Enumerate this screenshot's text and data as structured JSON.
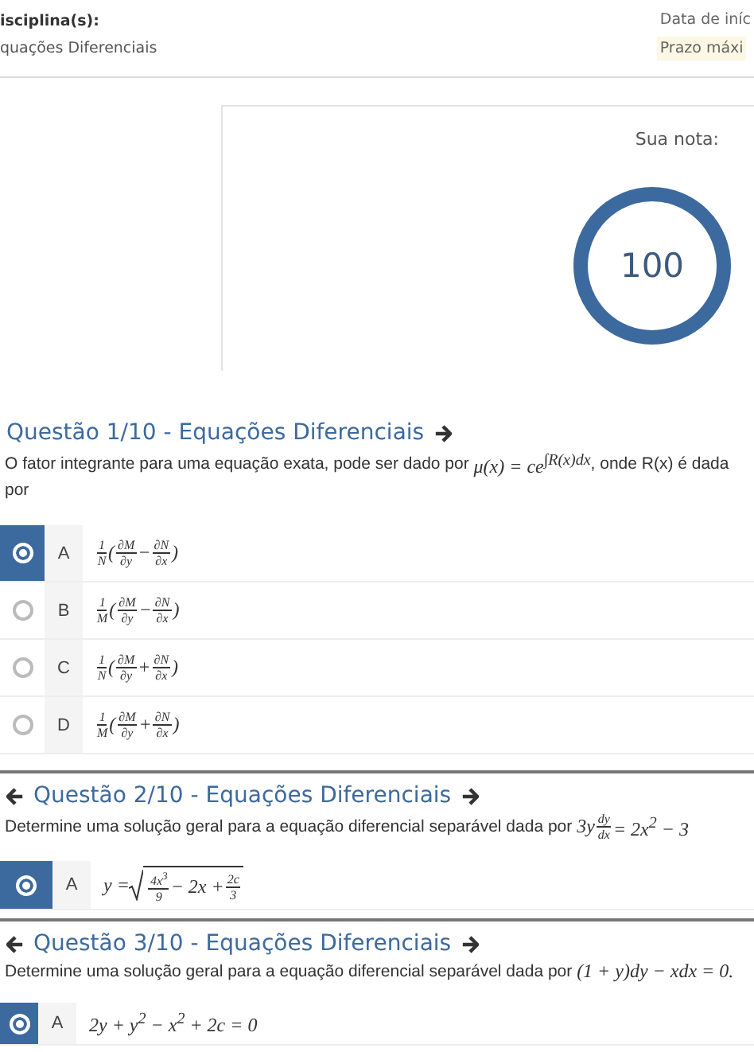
{
  "header": {
    "left": {
      "label": "isciplina(s):",
      "value": "quações Diferenciais"
    },
    "right": [
      {
        "text": "Data de iníc",
        "highlight": false
      },
      {
        "text": "Prazo máxi",
        "highlight": true
      }
    ]
  },
  "score": {
    "label": "Sua nota:",
    "value": "100",
    "level": 1
  },
  "questions": [
    {
      "title": "Questão 1/10 - Equações Diferenciais",
      "has_prev": false,
      "has_next": true,
      "statement": [
        {
          "kind": "text",
          "text": "O fator integrante para uma equação exata, pode ser dado por "
        },
        {
          "kind": "math",
          "tokens": [
            {
              "kind": "text",
              "text": "μ(x) = ce$^{∫R(x)dx}$"
            }
          ]
        },
        {
          "kind": "text",
          "text": ", onde R(x) é dada por"
        }
      ],
      "options": [
        {
          "letter": "A",
          "selected": true,
          "formula": [
            {
              "kind": "frac",
              "num": "1",
              "den": "N"
            },
            {
              "kind": "text",
              "text": "("
            },
            {
              "kind": "frac",
              "num": "∂M",
              "den": "∂y"
            },
            {
              "kind": "text",
              "text": " − "
            },
            {
              "kind": "frac",
              "num": "∂N",
              "den": "∂x"
            },
            {
              "kind": "text",
              "text": ")"
            }
          ]
        },
        {
          "letter": "B",
          "selected": false,
          "formula": [
            {
              "kind": "frac",
              "num": "1",
              "den": "M"
            },
            {
              "kind": "text",
              "text": "("
            },
            {
              "kind": "frac",
              "num": "∂M",
              "den": "∂y"
            },
            {
              "kind": "text",
              "text": " − "
            },
            {
              "kind": "frac",
              "num": "∂N",
              "den": "∂x"
            },
            {
              "kind": "text",
              "text": ")"
            }
          ]
        },
        {
          "letter": "C",
          "selected": false,
          "formula": [
            {
              "kind": "frac",
              "num": "1",
              "den": "N"
            },
            {
              "kind": "text",
              "text": "("
            },
            {
              "kind": "frac",
              "num": "∂M",
              "den": "∂y"
            },
            {
              "kind": "text",
              "text": " + "
            },
            {
              "kind": "frac",
              "num": "∂N",
              "den": "∂x"
            },
            {
              "kind": "text",
              "text": ")"
            }
          ]
        },
        {
          "letter": "D",
          "selected": false,
          "formula": [
            {
              "kind": "frac",
              "num": "1",
              "den": "M"
            },
            {
              "kind": "text",
              "text": "("
            },
            {
              "kind": "frac",
              "num": "∂M",
              "den": "∂y"
            },
            {
              "kind": "text",
              "text": " + "
            },
            {
              "kind": "frac",
              "num": "∂N",
              "den": "∂x"
            },
            {
              "kind": "text",
              "text": ")"
            }
          ]
        }
      ]
    },
    {
      "title": "Questão 2/10 - Equações Diferenciais",
      "has_prev": true,
      "has_next": true,
      "statement": [
        {
          "kind": "text",
          "text": "Determine uma solução geral para a equação diferencial separável dada por "
        },
        {
          "kind": "math",
          "tokens": [
            {
              "kind": "text",
              "text": "3y"
            },
            {
              "kind": "frac",
              "num": "dy",
              "den": "dx"
            },
            {
              "kind": "text",
              "text": " = 2x$^{2}$ − 3"
            }
          ]
        }
      ],
      "options": [
        {
          "letter": "A",
          "selected": true,
          "formula": [
            {
              "kind": "text",
              "text": "y = "
            },
            {
              "kind": "sqrt",
              "body": [
                {
                  "kind": "frac",
                  "num": "4x$^{3}$",
                  "den": "9"
                },
                {
                  "kind": "text",
                  "text": " − 2x + "
                },
                {
                  "kind": "frac",
                  "num": "2c",
                  "den": "3"
                }
              ]
            }
          ]
        }
      ]
    },
    {
      "title": "Questão 3/10 - Equações Diferenciais",
      "has_prev": true,
      "has_next": true,
      "statement": [
        {
          "kind": "text",
          "text": "Determine uma solução geral para a equação diferencial separável dada por "
        },
        {
          "kind": "math",
          "tokens": [
            {
              "kind": "text",
              "text": "(1 + y)dy − xdx = 0."
            }
          ]
        }
      ],
      "options": [
        {
          "letter": "A",
          "selected": true,
          "formula": [
            {
              "kind": "text",
              "text": "2y + y$^{2}$ − x$^{2}$ + 2c = 0"
            }
          ]
        }
      ]
    }
  ]
}
